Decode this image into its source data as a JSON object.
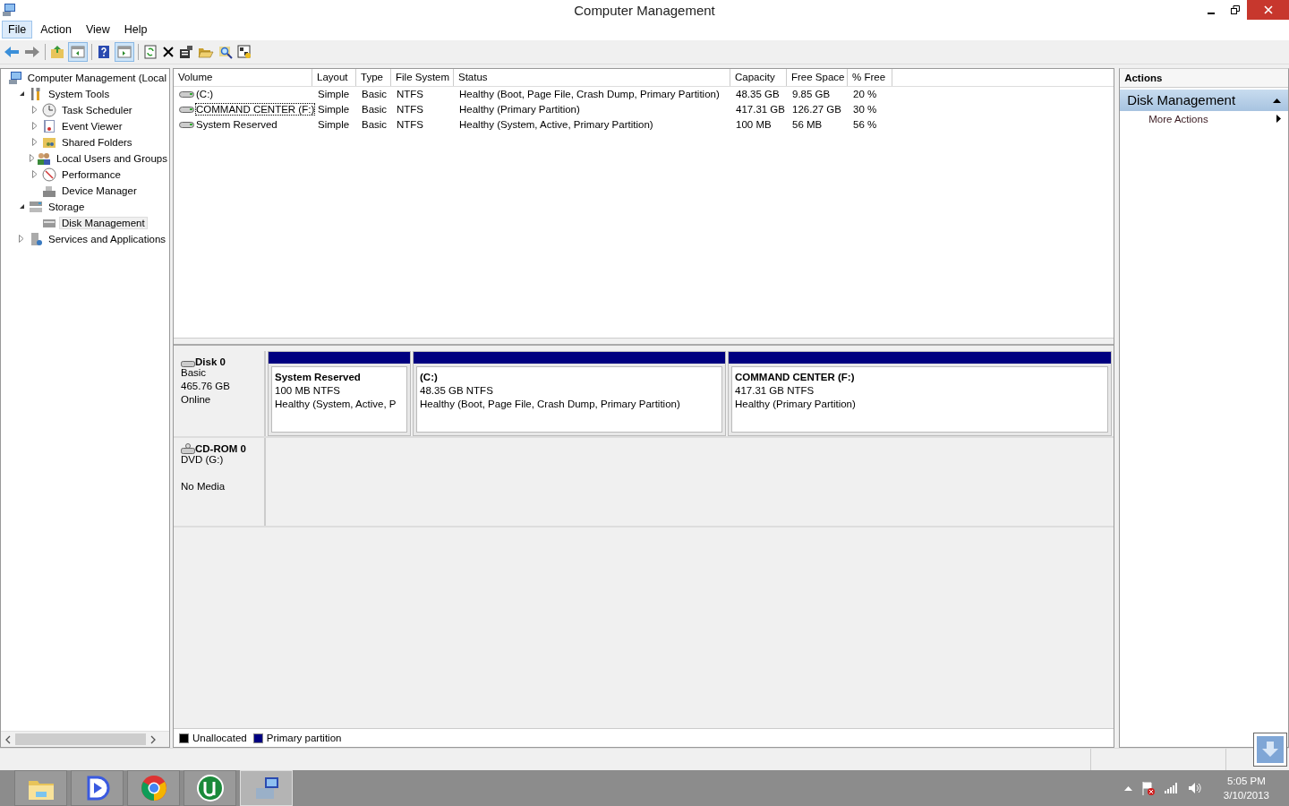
{
  "window": {
    "title": "Computer Management"
  },
  "menu": [
    {
      "label": "File",
      "selected": true
    },
    {
      "label": "Action",
      "selected": false
    },
    {
      "label": "View",
      "selected": false
    },
    {
      "label": "Help",
      "selected": false
    }
  ],
  "tree": [
    {
      "label": "Computer Management (Local",
      "selected": false,
      "children": [
        {
          "label": "System Tools",
          "expanded": true,
          "selected": false,
          "children": [
            {
              "label": "Task Scheduler",
              "expanded": false,
              "selected": false
            },
            {
              "label": "Event Viewer",
              "expanded": false,
              "selected": false
            },
            {
              "label": "Shared Folders",
              "expanded": false,
              "selected": false
            },
            {
              "label": "Local Users and Groups",
              "expanded": false,
              "selected": false
            },
            {
              "label": "Performance",
              "expanded": false,
              "selected": false
            },
            {
              "label": "Device Manager",
              "selected": false
            }
          ]
        },
        {
          "label": "Storage",
          "expanded": true,
          "selected": false,
          "children": [
            {
              "label": "Disk Management",
              "selected": true
            }
          ]
        },
        {
          "label": "Services and Applications",
          "expanded": false,
          "selected": false
        }
      ]
    }
  ],
  "volume_table": {
    "columns": [
      "Volume",
      "Layout",
      "Type",
      "File System",
      "Status",
      "Capacity",
      "Free Space",
      "% Free"
    ],
    "rows": [
      {
        "focused": false,
        "cells": [
          "(C:)",
          "Simple",
          "Basic",
          "NTFS",
          "Healthy (Boot, Page File, Crash Dump, Primary Partition)",
          "48.35 GB",
          "9.85 GB",
          "20 %"
        ]
      },
      {
        "focused": true,
        "cells": [
          "COMMAND CENTER (F:)",
          "Simple",
          "Basic",
          "NTFS",
          "Healthy (Primary Partition)",
          "417.31 GB",
          "126.27 GB",
          "30 %"
        ]
      },
      {
        "focused": false,
        "cells": [
          "System Reserved",
          "Simple",
          "Basic",
          "NTFS",
          "Healthy (System, Active, Primary Partition)",
          "100 MB",
          "56 MB",
          "56 %"
        ]
      }
    ]
  },
  "disks": [
    {
      "name": "Disk 0",
      "lines": [
        "Basic",
        "465.76 GB",
        "Online"
      ],
      "partitions": [
        {
          "name": "System Reserved",
          "size": "100 MB NTFS",
          "status": "Healthy (System, Active, P"
        },
        {
          "name": "(C:)",
          "size": "48.35 GB NTFS",
          "status": "Healthy (Boot, Page File, Crash Dump, Primary Partition)"
        },
        {
          "name": "COMMAND CENTER  (F:)",
          "size": "417.31 GB NTFS",
          "status": "Healthy (Primary Partition)"
        }
      ]
    },
    {
      "name": "CD-ROM 0",
      "lines": [
        "DVD (G:)",
        "No Media"
      ]
    }
  ],
  "legend": [
    {
      "label": "Unallocated",
      "color": "#000000"
    },
    {
      "label": "Primary partition",
      "color": "#000080"
    }
  ],
  "actions": {
    "title": "Actions",
    "section": "Disk Management",
    "items": [
      "More Actions"
    ]
  },
  "taskbar": {
    "apps": [
      {
        "selected": false
      },
      {
        "selected": false
      },
      {
        "selected": false
      },
      {
        "selected": false
      },
      {
        "selected": true
      }
    ],
    "time": "5:05 PM",
    "date": "3/10/2013"
  }
}
